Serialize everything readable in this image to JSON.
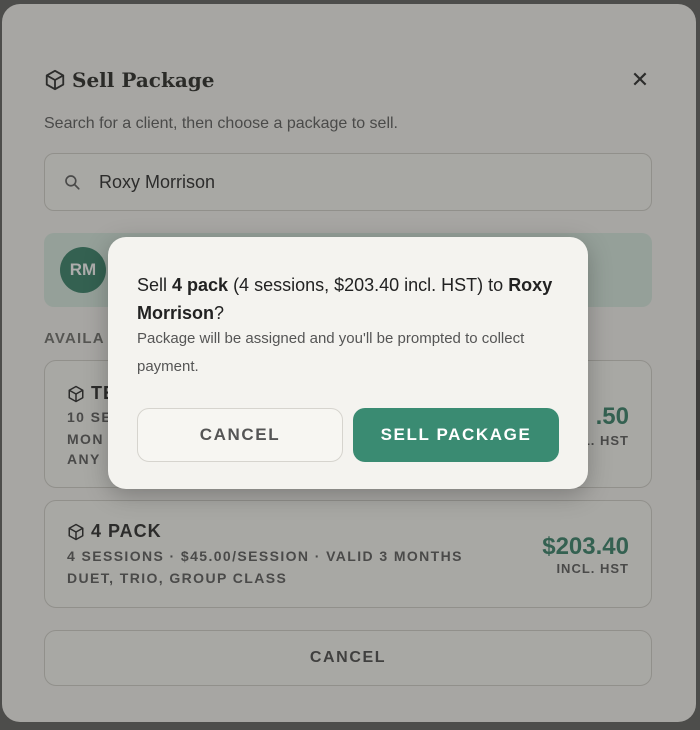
{
  "modal": {
    "title": "Sell Package",
    "close_symbol": "✕",
    "subtitle": "Search for a client, then choose a package to sell.",
    "search": {
      "value": "Roxy Morrison"
    },
    "client": {
      "initials": "RM"
    },
    "section_label": "AVAILA",
    "packages": [
      {
        "name": "TE",
        "line1": "10 SE",
        "line2": "MON",
        "line3": "ANY",
        "price": ".50",
        "price_note": "L. HST"
      },
      {
        "name": "4 PACK",
        "line1": "4 SESSIONS · $45.00/SESSION · VALID 3 MONTHS",
        "line2": "DUET, TRIO, GROUP CLASS",
        "price": "$203.40",
        "price_note": "INCL. HST"
      }
    ],
    "cancel_label": "CANCEL"
  },
  "confirm": {
    "prefix": "Sell ",
    "package_name": "4 pack",
    "middle": " (4 sessions, $203.40 incl. HST) to ",
    "client_name": "Roxy Morrison",
    "suffix": "?",
    "sub": "Package will be assigned and you'll be prompted to collect payment.",
    "cancel_label": "CANCEL",
    "sell_label": "SELL PACKAGE"
  },
  "colors": {
    "accent": "#3a8b72",
    "price": "#2f7c62",
    "client_card": "#d6e8df"
  },
  "icons": {
    "title": "package-cube-icon",
    "search": "search-icon",
    "close": "close-icon",
    "package": "package-cube-icon"
  }
}
